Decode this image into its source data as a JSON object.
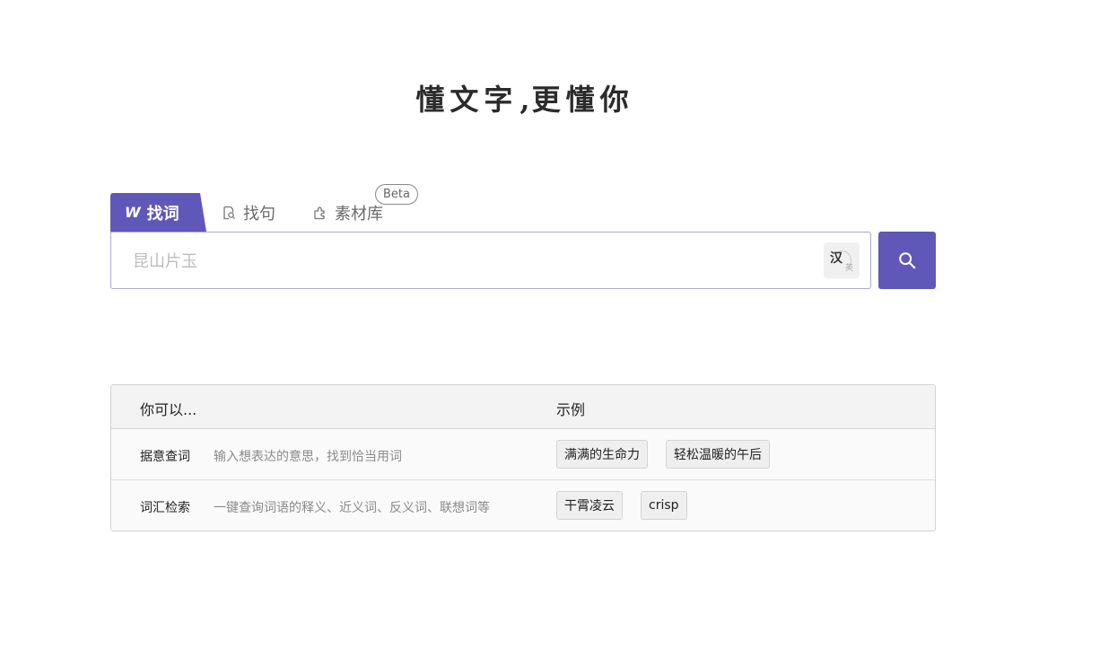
{
  "slogan": {
    "left": "懂文字",
    "separator": ",",
    "right": "更懂你"
  },
  "tabs": [
    {
      "label": "找词",
      "icon": "wq-logo-icon",
      "active": true
    },
    {
      "label": "找句",
      "icon": "document-search-icon",
      "active": false
    },
    {
      "label": "素材库",
      "icon": "puzzle-icon",
      "active": false
    }
  ],
  "beta_badge": "Beta",
  "search": {
    "placeholder": "昆山片玉",
    "value": "",
    "lang_toggle": {
      "primary": "汉",
      "secondary": "英"
    }
  },
  "help_table": {
    "headers": {
      "col1": "你可以...",
      "col2": "示例"
    },
    "rows": [
      {
        "feature": "据意查词",
        "description": "输入想表达的意思，找到恰当用词",
        "examples": [
          "满满的生命力",
          "轻松温暖的午后"
        ]
      },
      {
        "feature": "词汇检索",
        "description": "一键查询词语的释义、近义词、反义词、联想词等",
        "examples": [
          "干霄凌云",
          "crisp"
        ]
      }
    ]
  },
  "colors": {
    "accent": "#5f58b9",
    "border": "#a9a6d6"
  }
}
